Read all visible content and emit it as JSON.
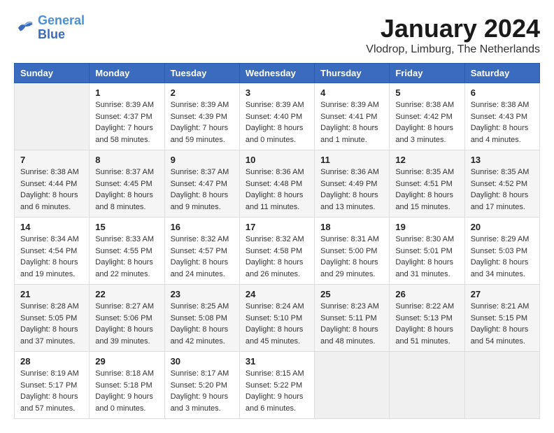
{
  "header": {
    "logo_line1": "General",
    "logo_line2": "Blue",
    "title": "January 2024",
    "subtitle": "Vlodrop, Limburg, The Netherlands"
  },
  "calendar": {
    "days_of_week": [
      "Sunday",
      "Monday",
      "Tuesday",
      "Wednesday",
      "Thursday",
      "Friday",
      "Saturday"
    ],
    "weeks": [
      [
        {
          "day": "",
          "info": ""
        },
        {
          "day": "1",
          "info": "Sunrise: 8:39 AM\nSunset: 4:37 PM\nDaylight: 7 hours\nand 58 minutes."
        },
        {
          "day": "2",
          "info": "Sunrise: 8:39 AM\nSunset: 4:39 PM\nDaylight: 7 hours\nand 59 minutes."
        },
        {
          "day": "3",
          "info": "Sunrise: 8:39 AM\nSunset: 4:40 PM\nDaylight: 8 hours\nand 0 minutes."
        },
        {
          "day": "4",
          "info": "Sunrise: 8:39 AM\nSunset: 4:41 PM\nDaylight: 8 hours\nand 1 minute."
        },
        {
          "day": "5",
          "info": "Sunrise: 8:38 AM\nSunset: 4:42 PM\nDaylight: 8 hours\nand 3 minutes."
        },
        {
          "day": "6",
          "info": "Sunrise: 8:38 AM\nSunset: 4:43 PM\nDaylight: 8 hours\nand 4 minutes."
        }
      ],
      [
        {
          "day": "7",
          "info": "Sunrise: 8:38 AM\nSunset: 4:44 PM\nDaylight: 8 hours\nand 6 minutes."
        },
        {
          "day": "8",
          "info": "Sunrise: 8:37 AM\nSunset: 4:45 PM\nDaylight: 8 hours\nand 8 minutes."
        },
        {
          "day": "9",
          "info": "Sunrise: 8:37 AM\nSunset: 4:47 PM\nDaylight: 8 hours\nand 9 minutes."
        },
        {
          "day": "10",
          "info": "Sunrise: 8:36 AM\nSunset: 4:48 PM\nDaylight: 8 hours\nand 11 minutes."
        },
        {
          "day": "11",
          "info": "Sunrise: 8:36 AM\nSunset: 4:49 PM\nDaylight: 8 hours\nand 13 minutes."
        },
        {
          "day": "12",
          "info": "Sunrise: 8:35 AM\nSunset: 4:51 PM\nDaylight: 8 hours\nand 15 minutes."
        },
        {
          "day": "13",
          "info": "Sunrise: 8:35 AM\nSunset: 4:52 PM\nDaylight: 8 hours\nand 17 minutes."
        }
      ],
      [
        {
          "day": "14",
          "info": "Sunrise: 8:34 AM\nSunset: 4:54 PM\nDaylight: 8 hours\nand 19 minutes."
        },
        {
          "day": "15",
          "info": "Sunrise: 8:33 AM\nSunset: 4:55 PM\nDaylight: 8 hours\nand 22 minutes."
        },
        {
          "day": "16",
          "info": "Sunrise: 8:32 AM\nSunset: 4:57 PM\nDaylight: 8 hours\nand 24 minutes."
        },
        {
          "day": "17",
          "info": "Sunrise: 8:32 AM\nSunset: 4:58 PM\nDaylight: 8 hours\nand 26 minutes."
        },
        {
          "day": "18",
          "info": "Sunrise: 8:31 AM\nSunset: 5:00 PM\nDaylight: 8 hours\nand 29 minutes."
        },
        {
          "day": "19",
          "info": "Sunrise: 8:30 AM\nSunset: 5:01 PM\nDaylight: 8 hours\nand 31 minutes."
        },
        {
          "day": "20",
          "info": "Sunrise: 8:29 AM\nSunset: 5:03 PM\nDaylight: 8 hours\nand 34 minutes."
        }
      ],
      [
        {
          "day": "21",
          "info": "Sunrise: 8:28 AM\nSunset: 5:05 PM\nDaylight: 8 hours\nand 37 minutes."
        },
        {
          "day": "22",
          "info": "Sunrise: 8:27 AM\nSunset: 5:06 PM\nDaylight: 8 hours\nand 39 minutes."
        },
        {
          "day": "23",
          "info": "Sunrise: 8:25 AM\nSunset: 5:08 PM\nDaylight: 8 hours\nand 42 minutes."
        },
        {
          "day": "24",
          "info": "Sunrise: 8:24 AM\nSunset: 5:10 PM\nDaylight: 8 hours\nand 45 minutes."
        },
        {
          "day": "25",
          "info": "Sunrise: 8:23 AM\nSunset: 5:11 PM\nDaylight: 8 hours\nand 48 minutes."
        },
        {
          "day": "26",
          "info": "Sunrise: 8:22 AM\nSunset: 5:13 PM\nDaylight: 8 hours\nand 51 minutes."
        },
        {
          "day": "27",
          "info": "Sunrise: 8:21 AM\nSunset: 5:15 PM\nDaylight: 8 hours\nand 54 minutes."
        }
      ],
      [
        {
          "day": "28",
          "info": "Sunrise: 8:19 AM\nSunset: 5:17 PM\nDaylight: 8 hours\nand 57 minutes."
        },
        {
          "day": "29",
          "info": "Sunrise: 8:18 AM\nSunset: 5:18 PM\nDaylight: 9 hours\nand 0 minutes."
        },
        {
          "day": "30",
          "info": "Sunrise: 8:17 AM\nSunset: 5:20 PM\nDaylight: 9 hours\nand 3 minutes."
        },
        {
          "day": "31",
          "info": "Sunrise: 8:15 AM\nSunset: 5:22 PM\nDaylight: 9 hours\nand 6 minutes."
        },
        {
          "day": "",
          "info": ""
        },
        {
          "day": "",
          "info": ""
        },
        {
          "day": "",
          "info": ""
        }
      ]
    ]
  }
}
